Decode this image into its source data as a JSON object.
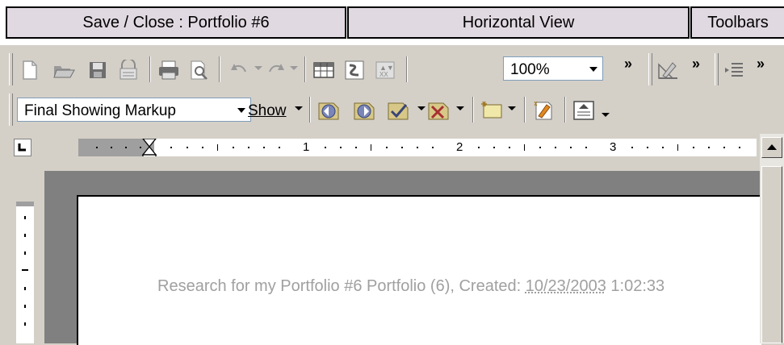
{
  "command_bar": {
    "save_close": "Save  /  Close : Portfolio #6",
    "horizontal_view": "Horizontal View",
    "toolbars": "Toolbars"
  },
  "toolbar1": {
    "zoom_value": "100%",
    "chevron": "»",
    "icons": [
      "new-document-icon",
      "open-folder-icon",
      "save-disk-icon",
      "permission-icon",
      "print-icon",
      "print-preview-icon",
      "undo-icon",
      "redo-icon",
      "insert-table-icon",
      "document-map-icon",
      "show-hide-icon",
      "drawing-icon",
      "bullets-indent-icon"
    ]
  },
  "toolbar2": {
    "markup_value": "Final Showing Markup",
    "show_label": "Show",
    "icons": [
      "previous-change-icon",
      "next-change-icon",
      "accept-change-icon",
      "reject-change-icon",
      "new-comment-icon",
      "track-changes-icon",
      "reviewing-pane-icon"
    ]
  },
  "ruler": {
    "numbers": [
      "1",
      "2",
      "3"
    ]
  },
  "document": {
    "text_prefix": "Research for my Portfolio #6 Portfolio (6), Created: ",
    "date": "10/23/2003",
    "text_suffix": " 1:02:33"
  },
  "colors": {
    "command_button_bg": "#e1d9e1",
    "toolbar_bg": "#d4d0c8",
    "doc_text": "#a0a0a0",
    "workspace": "#808080"
  }
}
